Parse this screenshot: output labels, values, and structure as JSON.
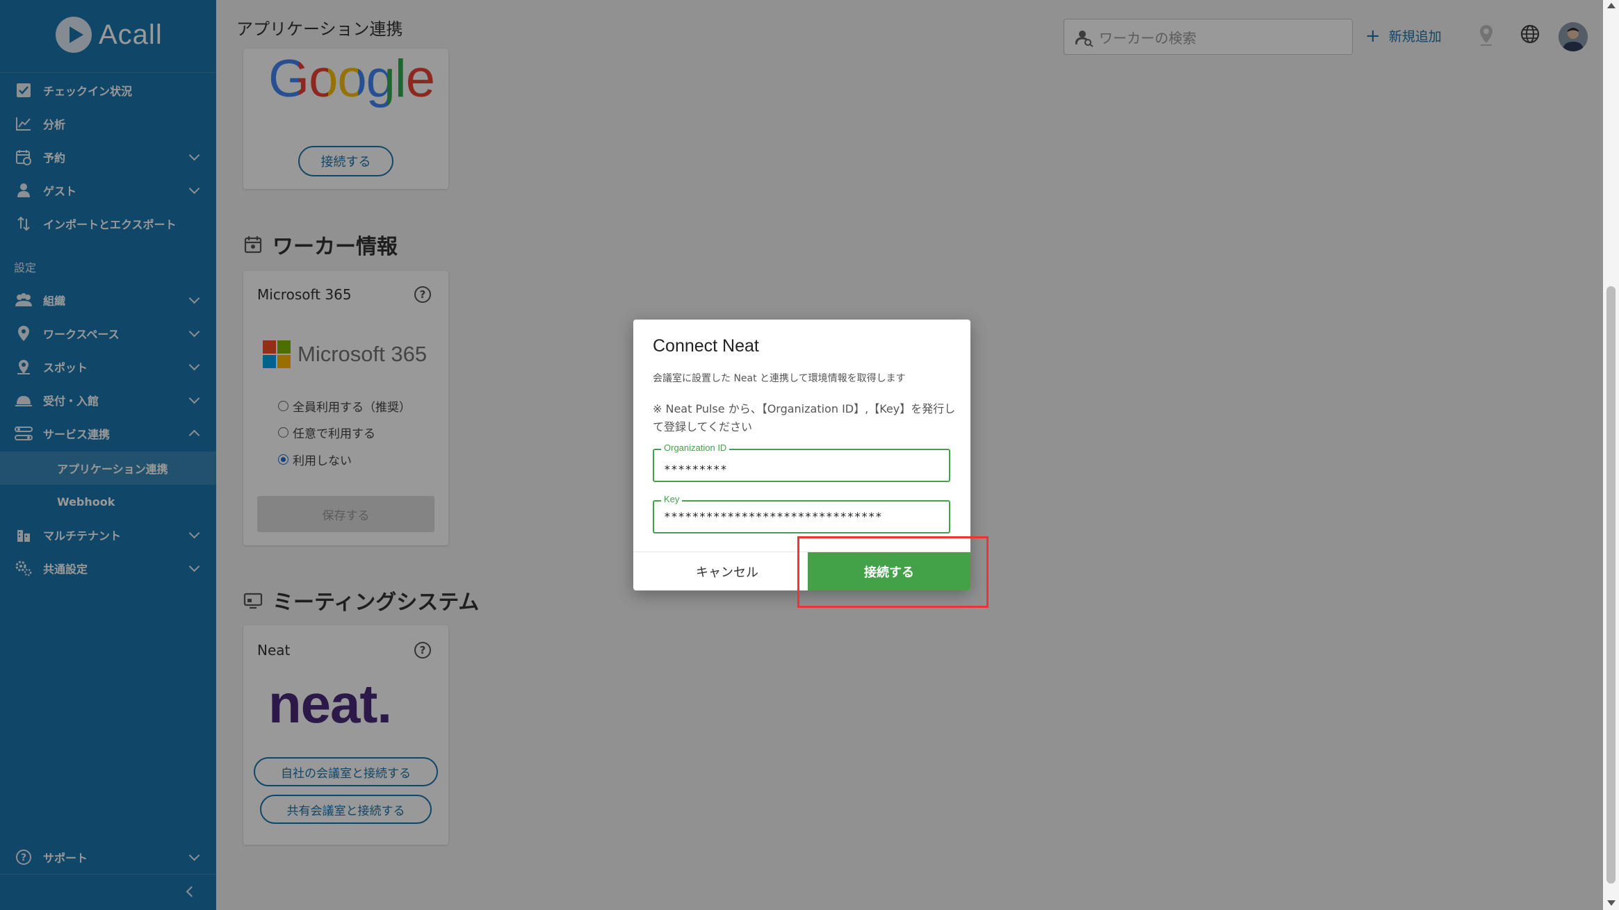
{
  "app": {
    "name": "Acall"
  },
  "header": {
    "title": "アプリケーション連携",
    "search_placeholder": "ワーカーの検索",
    "add_new": "新規追加"
  },
  "sidebar": {
    "items": [
      {
        "label": "チェックイン状況"
      },
      {
        "label": "分析"
      },
      {
        "label": "予約"
      },
      {
        "label": "ゲスト"
      },
      {
        "label": "インポートとエクスポート"
      }
    ],
    "section_label": "設定",
    "settings_items": [
      {
        "label": "組織"
      },
      {
        "label": "ワークスペース"
      },
      {
        "label": "スポット"
      },
      {
        "label": "受付・入館"
      },
      {
        "label": "サービス連携"
      }
    ],
    "sub_items": [
      {
        "label": "アプリケーション連携"
      },
      {
        "label": "Webhook"
      }
    ],
    "more_items": [
      {
        "label": "マルチテナント"
      },
      {
        "label": "共通設定"
      }
    ],
    "support": "サポート"
  },
  "google_card": {
    "logo_text": "Google",
    "button": "接続する"
  },
  "worker_section": {
    "heading": "ワーカー情報",
    "card_title": "Microsoft 365",
    "logo_text": "Microsoft 365",
    "options": [
      "全員利用する（推奨）",
      "任意で利用する",
      "利用しない"
    ],
    "selected": 2,
    "save_button": "保存する"
  },
  "meeting_section": {
    "heading": "ミーティングシステム",
    "card_title": "Neat",
    "logo_text": "neat.",
    "buttons": [
      "自社の会議室と接続する",
      "共有会議室と接続する"
    ]
  },
  "modal": {
    "title": "Connect Neat",
    "description": "会議室に設置した Neat と連携して環境情報を取得します",
    "note": "※ Neat Pulse から、【Organization ID】,【Key】を発行して登録してください",
    "org_id_label": "Organization ID",
    "org_id_value": "*********",
    "key_label": "Key",
    "key_value": "*******************************",
    "cancel": "キャンセル",
    "connect": "接続する"
  },
  "colors": {
    "sidebar": "#1b76ad",
    "accent_green": "#43a247",
    "highlight": "#ee3333",
    "neat_purple": "#4b2a7b"
  }
}
